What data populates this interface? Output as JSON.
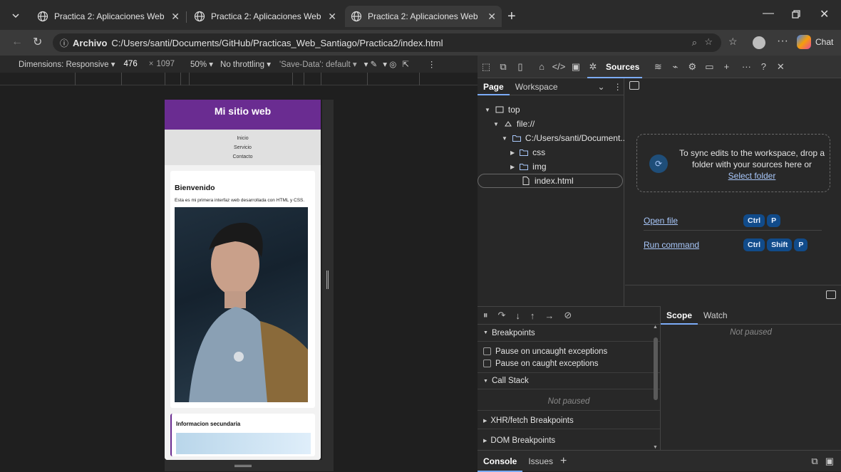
{
  "browser": {
    "tabs": [
      {
        "title": "Practica 2: Aplicaciones Web",
        "active": false
      },
      {
        "title": "Practica 2: Aplicaciones Web",
        "active": false
      },
      {
        "title": "Practica 2: Aplicaciones Web",
        "active": true
      }
    ],
    "address": {
      "badge": "Archivo",
      "url": "C:/Users/santi/Documents/GitHub/Practicas_Web_Santiago/Practica2/index.html"
    },
    "chat_label": "Chat"
  },
  "device_toolbar": {
    "dimensions": "Dimensions: Responsive",
    "width": "476",
    "height": "1097",
    "times": "×",
    "zoom": "50%",
    "throttling": "No throttling",
    "save_data": "'Save-Data': default"
  },
  "site": {
    "header": "Mi sitio web",
    "nav": [
      "Inicio",
      "Servicio",
      "Contacto"
    ],
    "welcome_title": "Bienvenido",
    "welcome_text": "Esta es mi primera interfaz web desarrollada con HTML y CSS.",
    "secondary_title": "Informacion secundaria"
  },
  "devtools": {
    "active_panel": "Sources",
    "nav_tabs": [
      "Page",
      "Workspace"
    ],
    "tree": {
      "top": "top",
      "origin": "file://",
      "folder": "C:/Users/santi/Document...",
      "css": "css",
      "img": "img",
      "file": "index.html"
    },
    "sync_text": "To sync edits to the workspace, drop a folder with your sources here or",
    "select_folder": "Select folder",
    "open_file": "Open file",
    "run_command": "Run command",
    "keys": {
      "ctrl": "Ctrl",
      "shift": "Shift",
      "p": "P"
    },
    "breakpoints": "Breakpoints",
    "pause_uncaught": "Pause on uncaught exceptions",
    "pause_caught": "Pause on caught exceptions",
    "call_stack": "Call Stack",
    "not_paused": "Not paused",
    "xhr": "XHR/fetch Breakpoints",
    "dom": "DOM Breakpoints",
    "scope": "Scope",
    "watch": "Watch",
    "drawer_tabs": [
      "Console",
      "Issues"
    ]
  }
}
